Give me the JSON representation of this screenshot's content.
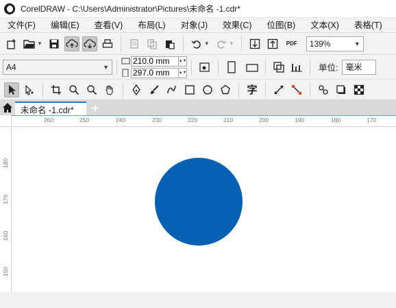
{
  "window": {
    "title": "CorelDRAW - C:\\Users\\Administrator\\Pictures\\未命名 -1.cdr*"
  },
  "menu": [
    "文件(F)",
    "编辑(E)",
    "查看(V)",
    "布局(L)",
    "对象(J)",
    "效果(C)",
    "位图(B)",
    "文本(X)",
    "表格(T)"
  ],
  "standard_toolbar": {
    "zoom": "139%",
    "pdf_label": "PDF"
  },
  "property_bar": {
    "page_size": "A4",
    "width": "210.0 mm",
    "height": "297.0 mm",
    "units_label": "单位:",
    "units_value": "毫米"
  },
  "document_tab": {
    "name": "未命名 -1.cdr*"
  },
  "rulers": {
    "horizontal": [
      "260",
      "250",
      "240",
      "230",
      "220",
      "210",
      "200",
      "190",
      "180",
      "170"
    ],
    "vertical": [
      "180",
      "170",
      "160",
      "150"
    ]
  },
  "canvas": {
    "circle_color": "#0661b2"
  },
  "colors": {
    "accent": "#2a7dd1",
    "ruler_line": "#5aa4e0"
  }
}
